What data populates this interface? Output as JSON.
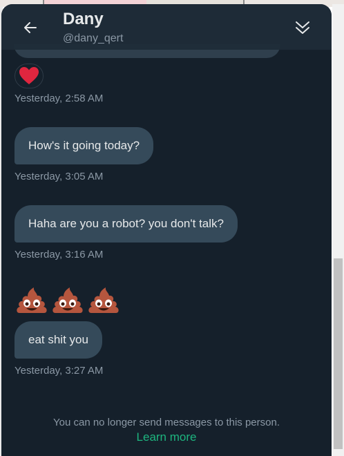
{
  "header": {
    "name": "Dany",
    "handle": "@dany_qert"
  },
  "messages": [
    {
      "text": "How's it going today?",
      "timestamp": "Yesterday, 3:05 AM"
    },
    {
      "text": "Haha are you a robot? you don't talk?",
      "timestamp": "Yesterday, 3:16 AM"
    },
    {
      "text": "eat shit you",
      "timestamp": "Yesterday, 3:27 AM"
    }
  ],
  "reaction": {
    "icon": "heart-icon",
    "timestamp": "Yesterday, 2:58 AM"
  },
  "emoji": {
    "name": "pile-of-poo-emoji",
    "count": 3
  },
  "footer": {
    "blocked_text": "You can no longer send messages to this person.",
    "learn_more": "Learn more"
  },
  "colors": {
    "background": "#15202b",
    "bubble": "#354a5a",
    "link": "#1db57f",
    "reaction": "#f91880"
  }
}
